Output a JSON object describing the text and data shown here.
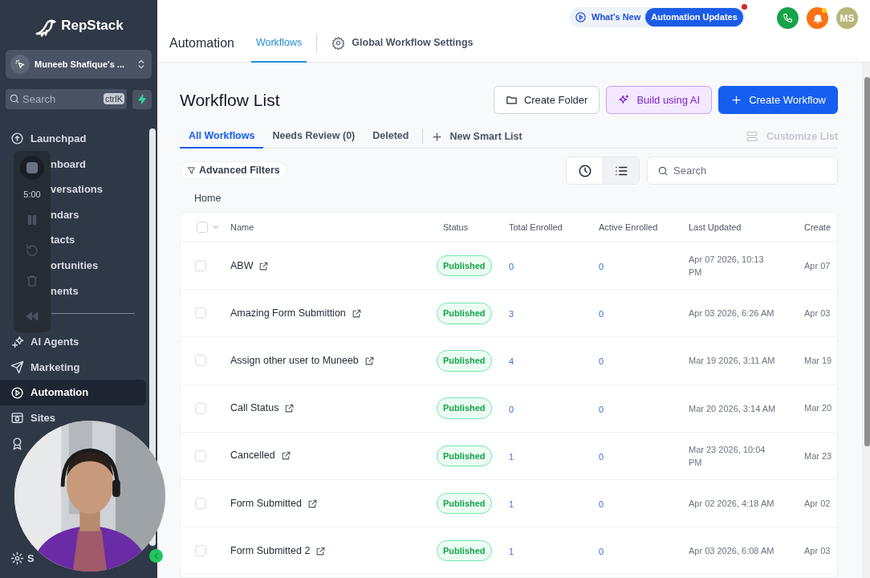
{
  "sidebar": {
    "logo": "RepStack",
    "account": "Muneeb Shafique's ...",
    "search": {
      "placeholder": "Search",
      "shortcut": "ctrlK"
    },
    "nav": [
      {
        "kind": "full",
        "label": "Launchpad",
        "selected": false
      },
      {
        "kind": "partly_hidden",
        "label": "nboard",
        "selected": false
      },
      {
        "kind": "partly_hidden",
        "label": "versations",
        "selected": false
      },
      {
        "kind": "partly_hidden",
        "label": "ndars",
        "selected": false
      },
      {
        "kind": "partly_hidden",
        "label": "tacts",
        "selected": false
      },
      {
        "kind": "partly_hidden",
        "label": "ortunities",
        "selected": false
      },
      {
        "kind": "partly_hidden",
        "label": "nents",
        "selected": false
      },
      {
        "kind": "divider"
      },
      {
        "kind": "full",
        "label": "AI Agents",
        "selected": false
      },
      {
        "kind": "full",
        "label": "Marketing",
        "selected": false
      },
      {
        "kind": "full",
        "label": "Automation",
        "selected": true
      },
      {
        "kind": "full",
        "label": "Sites",
        "selected": false
      },
      {
        "kind": "icon_only",
        "selected": false
      }
    ],
    "settings_label": "S"
  },
  "recorder": {
    "timer": "5:00"
  },
  "header": {
    "title": "Automation",
    "tabs": [
      {
        "label": "Workflows",
        "selected": true
      },
      {
        "label": "Global Workflow Settings",
        "selected": false
      }
    ],
    "whats_new": "What's New",
    "updates_badge": "Automation Updates",
    "updates_unread": true,
    "notifications_unread": true,
    "avatar": "MS"
  },
  "page": {
    "title": "Workflow List",
    "buttons": [
      {
        "kind": "outline",
        "label": "Create Folder"
      },
      {
        "kind": "ai",
        "label": "Build using AI"
      },
      {
        "kind": "primary",
        "label": "Create Workflow"
      }
    ],
    "list_tabs": [
      {
        "label": "All Workflows",
        "selected": true
      },
      {
        "label": "Needs Review (0)",
        "selected": false
      },
      {
        "label": "Deleted",
        "selected": false
      }
    ],
    "new_smart_list": "New Smart List",
    "customize_list": {
      "label": "Customize List",
      "disabled": true
    },
    "advanced_filters": "Advanced Filters",
    "views": [
      {
        "kind": "clock",
        "selected": false
      },
      {
        "kind": "list",
        "selected": true
      }
    ],
    "search": {
      "placeholder": "Search"
    },
    "breadcrumb": "Home"
  },
  "table": {
    "all_checked": false,
    "columns": [
      "Name",
      "Status",
      "Total Enrolled",
      "Active Enrolled",
      "Last Updated",
      "Create"
    ],
    "rows": [
      {
        "checked": false,
        "name": "ABW",
        "status": "Published",
        "total_enrolled": "0",
        "active_enrolled": "0",
        "last_updated": "Apr 07 2026, 10:13 PM",
        "created": "Apr 07"
      },
      {
        "checked": false,
        "name": "Amazing Form Submittion",
        "status": "Published",
        "total_enrolled": "3",
        "active_enrolled": "0",
        "last_updated": "Apr 03 2026, 6:26 AM",
        "created": "Apr 03"
      },
      {
        "checked": false,
        "name": "Assign other user to Muneeb",
        "status": "Published",
        "total_enrolled": "4",
        "active_enrolled": "0",
        "last_updated": "Mar 19 2026, 3:11 AM",
        "created": "Mar 19"
      },
      {
        "checked": false,
        "name": "Call Status",
        "status": "Published",
        "total_enrolled": "0",
        "active_enrolled": "0",
        "last_updated": "Mar 20 2026, 3:14 AM",
        "created": "Mar 20"
      },
      {
        "checked": false,
        "name": "Cancelled",
        "status": "Published",
        "total_enrolled": "1",
        "active_enrolled": "0",
        "last_updated": "Mar 23 2026, 10:04 PM",
        "created": "Mar 23"
      },
      {
        "checked": false,
        "name": "Form Submitted",
        "status": "Published",
        "total_enrolled": "1",
        "active_enrolled": "0",
        "last_updated": "Apr 02 2026, 4:18 AM",
        "created": "Apr 02"
      },
      {
        "checked": false,
        "name": "Form Submitted 2",
        "status": "Published",
        "total_enrolled": "1",
        "active_enrolled": "0",
        "last_updated": "Apr 03 2026, 6:08 AM",
        "created": "Apr 03"
      }
    ]
  }
}
